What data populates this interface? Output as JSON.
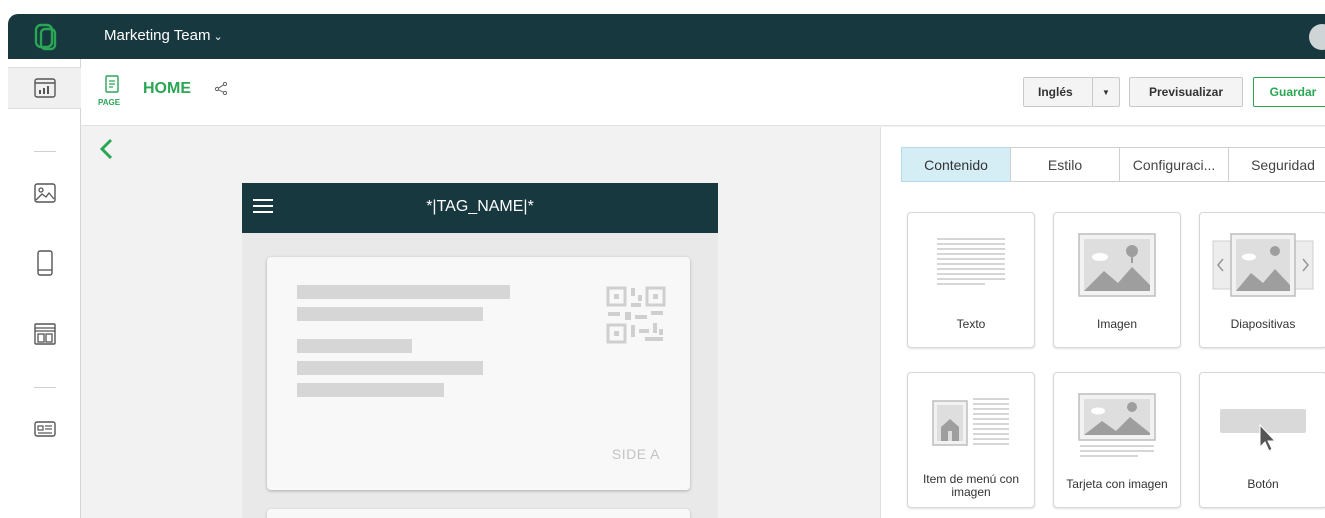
{
  "header": {
    "team_name": "Marketing Team",
    "team_chevron": "chevron-down-icon",
    "logo": "brand-logo"
  },
  "sidebar": {
    "items": [
      {
        "icon": "analytics-icon",
        "active": true
      },
      {
        "icon": "image-icon"
      },
      {
        "icon": "mobile-icon"
      },
      {
        "icon": "layout-icon"
      },
      {
        "icon": "card-icon"
      }
    ]
  },
  "page": {
    "kind": "PAGE",
    "title": "HOME"
  },
  "toolbar": {
    "language": "Inglés",
    "preview": "Previsualizar",
    "save": "Guardar"
  },
  "canvas": {
    "tag_name": "*|TAG_NAME|*",
    "side_label": "SIDE A"
  },
  "panel": {
    "tabs": [
      {
        "label": "Contenido",
        "active": true
      },
      {
        "label": "Estilo"
      },
      {
        "label": "Configuraci..."
      },
      {
        "label": "Seguridad"
      }
    ],
    "tiles": [
      {
        "label": "Texto"
      },
      {
        "label": "Imagen"
      },
      {
        "label": "Diapositivas"
      },
      {
        "label": "Item de menú con imagen"
      },
      {
        "label": "Tarjeta con imagen"
      },
      {
        "label": "Botón"
      }
    ]
  },
  "colors": {
    "topbar": "#17383f",
    "accent_green": "#2aa654",
    "active_tab": "#d5eef6"
  }
}
